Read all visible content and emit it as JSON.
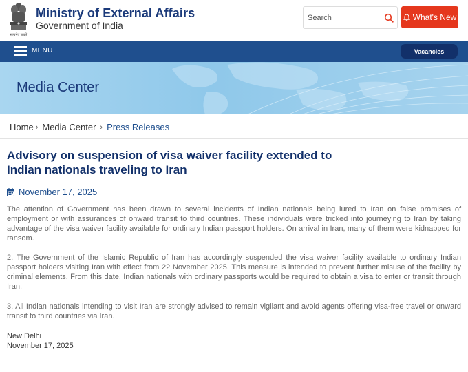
{
  "header": {
    "title": "Ministry of External Affairs",
    "subtitle": "Government of India",
    "emblem_caption": "सत्यमेव जयते",
    "search": {
      "placeholder": "Search"
    },
    "whats_new_label": "What's New"
  },
  "navbar": {
    "menu_label": "MENU",
    "vacancies_label": "Vacancies"
  },
  "banner": {
    "title": "Media Center"
  },
  "breadcrumb": {
    "items": [
      "Home",
      "Media Center",
      "Press Releases"
    ],
    "separator": "›"
  },
  "article": {
    "title": "Advisory on suspension of visa waiver facility extended to Indian nationals traveling to Iran",
    "date": "November 17, 2025",
    "paragraphs": [
      "The attention of Government has been drawn to several incidents of Indian nationals being lured to Iran on false promises of employment or with assurances of onward transit to third countries. These individuals were tricked into journeying to Iran by taking advantage of the visa waiver facility available for ordinary Indian passport holders. On arrival in Iran, many of them were kidnapped for ransom.",
      "2. The Government of the Islamic Republic of Iran has accordingly suspended the visa waiver facility available to ordinary Indian passport holders visiting Iran with effect from 22 November 2025. This measure is intended to prevent further misuse of the facility by criminal elements. From this date, Indian nationals with ordinary passports would be required to obtain a visa to enter or transit through Iran.",
      "3. All Indian nationals intending to visit Iran are strongly advised to remain vigilant and avoid agents offering visa-free travel or onward transit to third countries via Iran."
    ],
    "place": "New Delhi",
    "signoff_date": "November 17, 2025"
  },
  "colors": {
    "brand_navy": "#1b3a7a",
    "nav_blue": "#1f4f8e",
    "whats_new_red": "#e5371d",
    "vacancies_bg": "#12306a",
    "banner_blue": "#8fc8ea"
  },
  "icons": [
    "national-emblem",
    "search-icon",
    "bell-icon",
    "hamburger-icon",
    "calendar-icon"
  ]
}
